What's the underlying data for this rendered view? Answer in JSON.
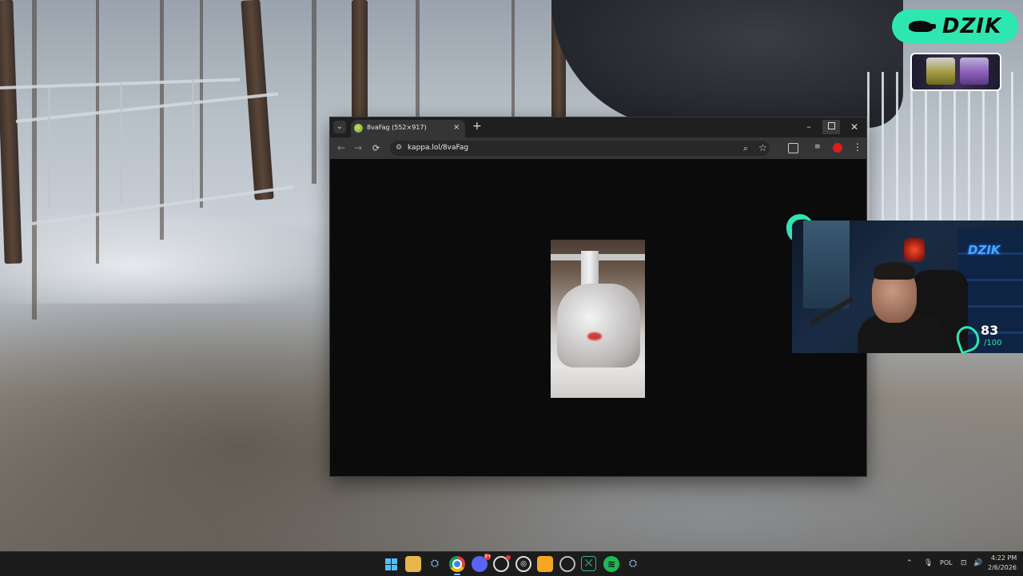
{
  "overlay": {
    "brand_text": "DZIK",
    "brand_color": "#2ee6b0",
    "webcam_brand_text": "DZIK",
    "score": "83",
    "score_max": "/100"
  },
  "browser": {
    "tab_title": "8vaFag (552×917)",
    "tab_close": "×",
    "new_tab": "+",
    "tab_list": "⌄",
    "window_minimize": "–",
    "window_close": "✕",
    "nav_back": "←",
    "nav_forward": "→",
    "nav_reload": "⟳",
    "url": "kappa.lol/8vaFag",
    "site_info_icon": "tune-icon",
    "zoom_icon": "⌕",
    "bookmark_icon": "☆",
    "menu_icon": "⋮",
    "media_icon": "≡",
    "record_color": "#e21b1b"
  },
  "taskbar": {
    "apps": [
      "start",
      "file-explorer",
      "steam",
      "chrome",
      "discord",
      "obs",
      "app",
      "app",
      "app",
      "app",
      "spotify",
      "steam"
    ],
    "discord_badge": "9+",
    "tray_chevron": "⌃",
    "tray_mic": "🎙",
    "language": "POL",
    "tray_network": "⊡",
    "tray_speaker": "🔊",
    "clock_time": "4:22 PM",
    "clock_date": "2/6/2026"
  }
}
